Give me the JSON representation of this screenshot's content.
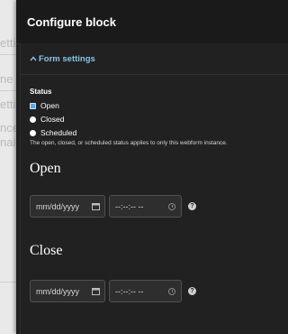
{
  "dialog": {
    "title": "Configure block"
  },
  "form_settings": {
    "summary_label": "Form settings",
    "status": {
      "label": "Status",
      "options": [
        {
          "label": "Open",
          "checked": true
        },
        {
          "label": "Closed",
          "checked": false
        },
        {
          "label": "Scheduled",
          "checked": false
        }
      ],
      "help": "The open, closed, or scheduled status applies to only this webform instance."
    },
    "open": {
      "heading": "Open",
      "date_placeholder": "mm/dd/yyyy",
      "time_placeholder": "--:--:-- --"
    },
    "close": {
      "heading": "Close",
      "date_placeholder": "mm/dd/yyyy",
      "time_placeholder": "--:--:-- --"
    }
  },
  "background": {
    "fragments": [
      "etti",
      "ne ma",
      "etti",
      "nce",
      "nail"
    ]
  },
  "colors": {
    "dialog_bg": "#1e1e1e",
    "summary_link": "#86c3ea",
    "checked_radio": "#5aa5ff"
  }
}
